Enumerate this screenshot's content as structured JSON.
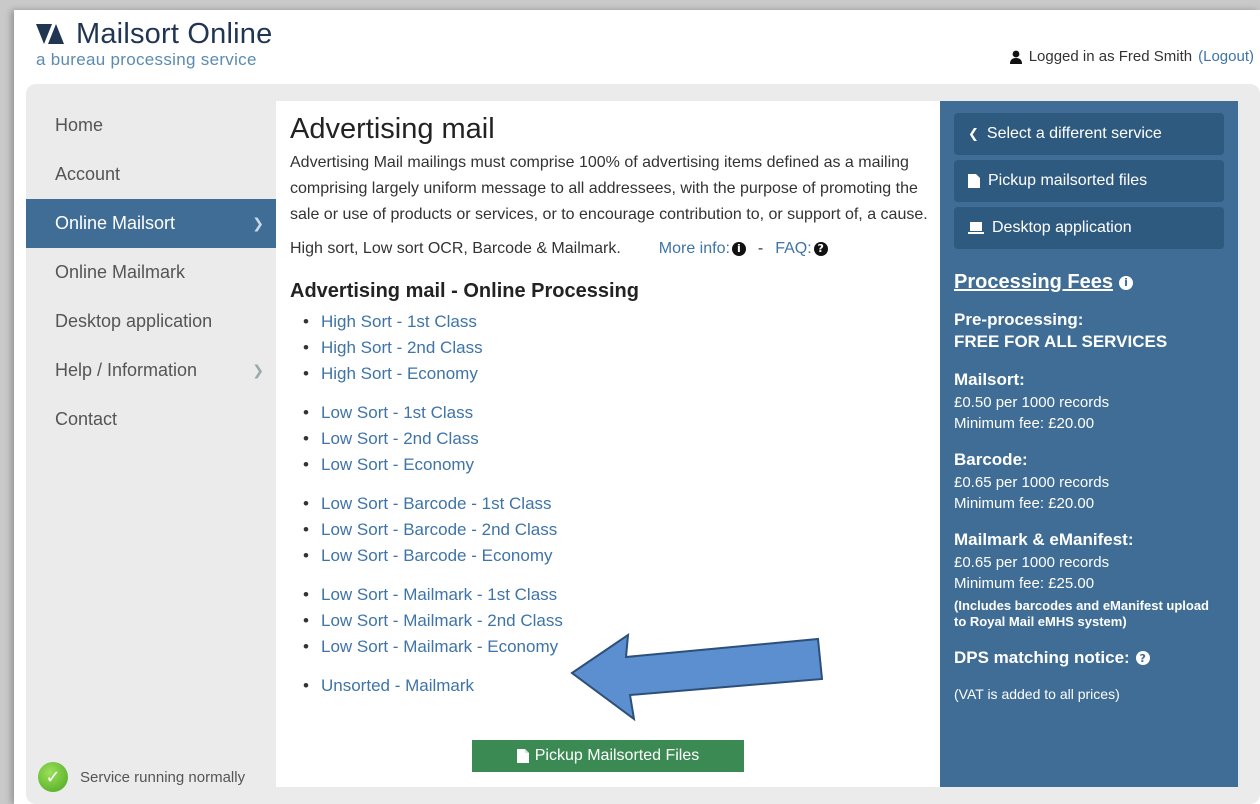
{
  "header": {
    "logo_main": "Mailsort Online",
    "logo_sub": "a bureau processing service",
    "logged_in_text": "Logged in as Fred Smith",
    "logout_label": "(Logout)"
  },
  "sidebar": {
    "items": [
      {
        "label": "Home",
        "chevron": false
      },
      {
        "label": "Account",
        "chevron": false
      },
      {
        "label": "Online Mailsort",
        "chevron": true,
        "active": true
      },
      {
        "label": "Online Mailmark",
        "chevron": false
      },
      {
        "label": "Desktop application",
        "chevron": false
      },
      {
        "label": "Help / Information",
        "chevron": true
      },
      {
        "label": "Contact",
        "chevron": false
      }
    ],
    "status": "Service running normally"
  },
  "content": {
    "title": "Advertising mail",
    "description": "Advertising Mail mailings must comprise 100% of advertising items defined as a mailing comprising largely uniform message to all addressees, with the purpose of promoting the sale or use of products or services, or to encourage contribution to, or support of, a cause.",
    "sort_types": "High sort, Low sort OCR, Barcode & Mailmark.",
    "more_info": "More info:",
    "separator": "-",
    "faq": "FAQ:",
    "subtitle": "Advertising mail - Online Processing",
    "services": [
      "High Sort - 1st Class",
      "High Sort - 2nd Class",
      "High Sort - Economy",
      "Low Sort - 1st Class",
      "Low Sort - 2nd Class",
      "Low Sort - Economy",
      "Low Sort - Barcode - 1st Class",
      "Low Sort - Barcode - 2nd Class",
      "Low Sort - Barcode - Economy",
      "Low Sort - Mailmark - 1st Class",
      "Low Sort - Mailmark - 2nd Class",
      "Low Sort - Mailmark - Economy",
      "Unsorted - Mailmark"
    ],
    "pickup_button": "Pickup Mailsorted Files"
  },
  "right_panel": {
    "buttons": [
      "Select a different service",
      "Pickup mailsorted files",
      "Desktop application"
    ],
    "fees_title": "Processing Fees",
    "preprocessing_label": "Pre-processing:",
    "preprocessing_value": "FREE FOR ALL SERVICES",
    "mailsort_label": "Mailsort:",
    "mailsort_rate": "£0.50 per 1000 records",
    "mailsort_min": "Minimum fee: £20.00",
    "barcode_label": "Barcode:",
    "barcode_rate": "£0.65 per 1000 records",
    "barcode_min": "Minimum fee: £20.00",
    "mailmark_label": "Mailmark & eManifest:",
    "mailmark_rate": "£0.65 per 1000 records",
    "mailmark_min": "Minimum fee: £25.00",
    "mailmark_note": "(Includes barcodes and eManifest upload to Royal Mail eMHS system)",
    "dps_label": "DPS matching notice:",
    "vat_note": "(VAT is added to all prices)"
  },
  "colors": {
    "accent": "#3f6d95",
    "link": "#3e74a8",
    "button_green": "#3b8a53",
    "arrow_fill": "#5b8fcf"
  }
}
